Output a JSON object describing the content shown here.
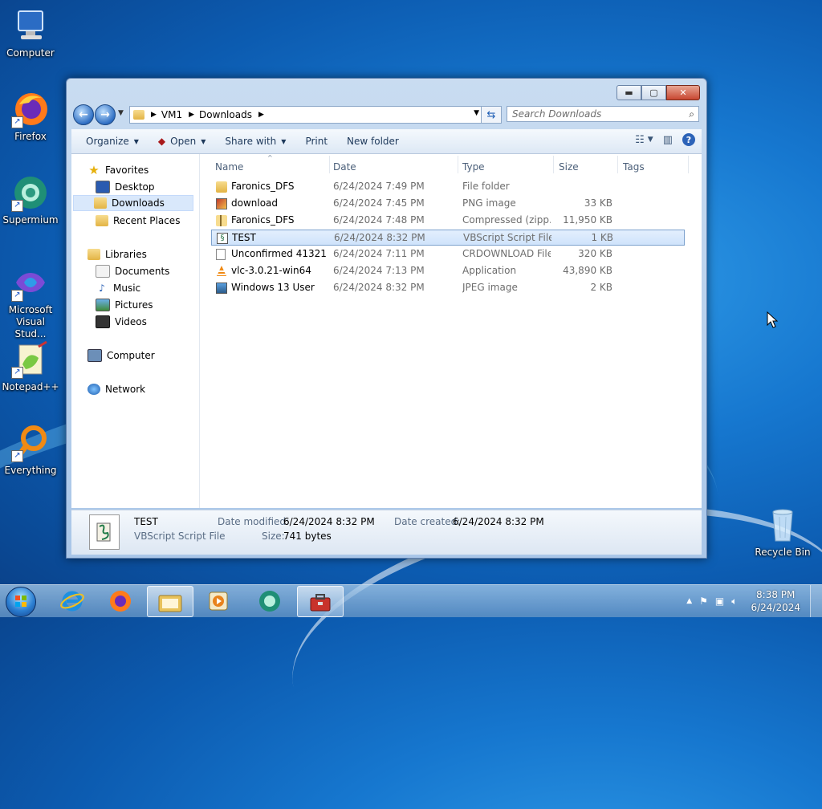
{
  "desktop": {
    "icons": [
      {
        "label": "Computer",
        "icon": "computer-icon"
      },
      {
        "label": "Firefox",
        "icon": "firefox-icon"
      },
      {
        "label": "Supermium",
        "icon": "supermium-icon"
      },
      {
        "label": "Microsoft Visual Stud...",
        "icon": "visual-studio-icon"
      },
      {
        "label": "Notepad++",
        "icon": "notepadpp-icon"
      },
      {
        "label": "Everything",
        "icon": "everything-icon"
      },
      {
        "label": "Recycle Bin",
        "icon": "recycle-bin-icon"
      }
    ]
  },
  "explorer": {
    "address": {
      "segments": [
        "VM1",
        "Downloads"
      ]
    },
    "search": {
      "placeholder": "Search Downloads"
    },
    "toolbar": {
      "organize": "Organize",
      "open": "Open",
      "share_with": "Share with",
      "print": "Print",
      "new_folder": "New folder"
    },
    "nav": {
      "favorites": "Favorites",
      "desktop": "Desktop",
      "downloads": "Downloads",
      "recent_places": "Recent Places",
      "libraries": "Libraries",
      "documents": "Documents",
      "music": "Music",
      "pictures": "Pictures",
      "videos": "Videos",
      "computer": "Computer",
      "network": "Network",
      "selected": "Downloads"
    },
    "columns": {
      "name": "Name",
      "date": "Date",
      "type": "Type",
      "size": "Size",
      "tags": "Tags"
    },
    "files": [
      {
        "name": "Faronics_DFS",
        "date": "6/24/2024 7:49 PM",
        "type": "File folder",
        "size": "",
        "icon": "folder-icon"
      },
      {
        "name": "download",
        "date": "6/24/2024 7:45 PM",
        "type": "PNG image",
        "size": "33 KB",
        "icon": "png-image-icon"
      },
      {
        "name": "Faronics_DFS",
        "date": "6/24/2024 7:48 PM",
        "type": "Compressed (zipp...",
        "size": "11,950 KB",
        "icon": "zip-folder-icon"
      },
      {
        "name": "TEST",
        "date": "6/24/2024 8:32 PM",
        "type": "VBScript Script File",
        "size": "1 KB",
        "icon": "vbscript-icon",
        "selected": true
      },
      {
        "name": "Unconfirmed 41321...",
        "date": "6/24/2024 7:11 PM",
        "type": "CRDOWNLOAD File",
        "size": "320 KB",
        "icon": "blank-file-icon"
      },
      {
        "name": "vlc-3.0.21-win64",
        "date": "6/24/2024 7:13 PM",
        "type": "Application",
        "size": "43,890 KB",
        "icon": "vlc-icon"
      },
      {
        "name": "Windows 13 User",
        "date": "6/24/2024 8:32 PM",
        "type": "JPEG image",
        "size": "2 KB",
        "icon": "jpeg-image-icon"
      }
    ],
    "details": {
      "name": "TEST",
      "type": "VBScript Script File",
      "date_modified_label": "Date modified:",
      "date_modified": "6/24/2024 8:32 PM",
      "date_created_label": "Date created:",
      "date_created": "6/24/2024 8:32 PM",
      "size_label": "Size:",
      "size": "741 bytes"
    }
  },
  "taskbar": {
    "pinned": [
      "internet-explorer-icon",
      "firefox-icon",
      "file-explorer-icon",
      "media-player-icon",
      "supermium-icon",
      "toolbox-icon"
    ],
    "clock": {
      "time": "8:38 PM",
      "date": "6/24/2024"
    }
  }
}
